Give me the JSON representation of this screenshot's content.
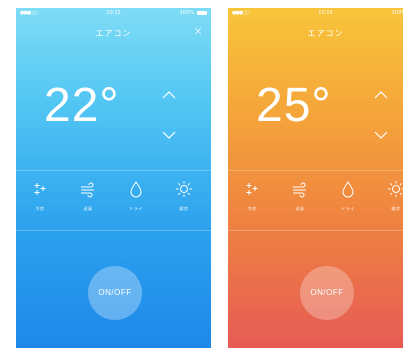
{
  "screens": [
    {
      "status": {
        "signal": "●●●○○",
        "time": "10:15",
        "battery": "100%"
      },
      "title": "エアコン",
      "close_label": "×",
      "temperature": "22°",
      "modes": [
        {
          "label": "冷房",
          "icon": "snowflake-icon"
        },
        {
          "label": "送風",
          "icon": "wind-icon"
        },
        {
          "label": "ドライ",
          "icon": "droplet-icon"
        },
        {
          "label": "暖房",
          "icon": "sun-icon"
        }
      ],
      "power_label": "ON/OFF"
    },
    {
      "status": {
        "signal": "●●●○○",
        "time": "10:15",
        "battery": "100%"
      },
      "title": "エアコン",
      "temperature": "25°",
      "modes": [
        {
          "label": "冷房",
          "icon": "snowflake-icon"
        },
        {
          "label": "送風",
          "icon": "wind-icon"
        },
        {
          "label": "ドライ",
          "icon": "droplet-icon"
        },
        {
          "label": "暖房",
          "icon": "sun-icon"
        }
      ],
      "power_label": "ON/OFF"
    }
  ],
  "colors": {
    "cool_gradient": [
      "#7fdcf6",
      "#1e88ea"
    ],
    "heat_gradient": [
      "#f8c53a",
      "#e65b55"
    ]
  }
}
